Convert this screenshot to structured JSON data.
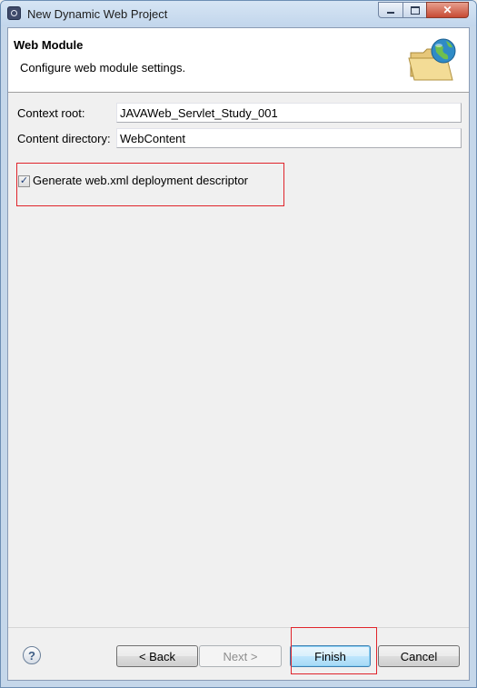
{
  "window": {
    "title": "New Dynamic Web Project",
    "controls": {
      "minimize": "",
      "maximize": "",
      "close": "✕"
    }
  },
  "banner": {
    "title": "Web Module",
    "subtitle": "Configure web module settings.",
    "icon": "folder-globe-icon"
  },
  "form": {
    "context_root": {
      "label": "Context root:",
      "value": "JAVAWeb_Servlet_Study_001"
    },
    "content_directory": {
      "label": "Content directory:",
      "value": "WebContent"
    }
  },
  "options": {
    "generate_descriptor": {
      "label": "Generate web.xml deployment descriptor",
      "checked": true,
      "mark": "✓"
    }
  },
  "footer": {
    "help": "?",
    "back": "< Back",
    "next": "Next >",
    "finish": "Finish",
    "cancel": "Cancel"
  },
  "colors": {
    "annotation": "#e0242b",
    "title_bar": "#c5d7ea",
    "default_button": "#bee6fd"
  }
}
